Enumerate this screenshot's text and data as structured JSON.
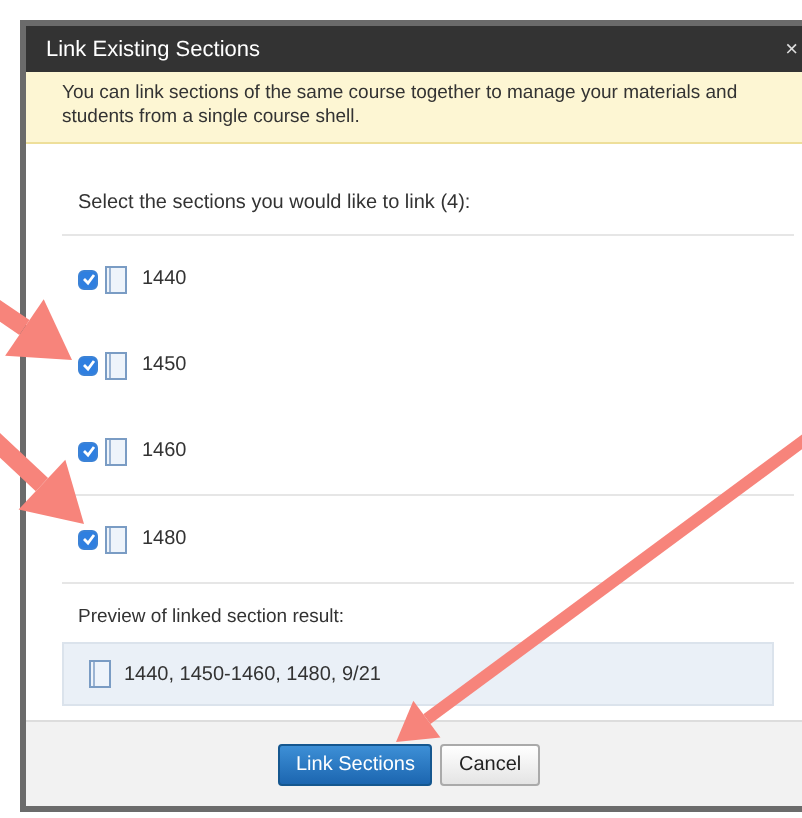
{
  "window": {
    "title": "Link Existing Sections",
    "close": "×"
  },
  "message": "You can link sections of the same course together to manage your materials and students from a single course shell.",
  "instruction": "Select the sections you would like to link (4):",
  "sections": [
    {
      "label": "1440",
      "checked": true
    },
    {
      "label": "1450",
      "checked": true
    },
    {
      "label": "1460",
      "checked": true
    },
    {
      "label": "1480",
      "checked": true
    }
  ],
  "preview": {
    "label": "Preview of linked section result:",
    "value": "1440, 1450-1460, 1480, 9/21"
  },
  "buttons": [
    {
      "label": "Link Sections",
      "kind": "primary"
    },
    {
      "label": "Cancel",
      "kind": "secondary"
    }
  ]
}
